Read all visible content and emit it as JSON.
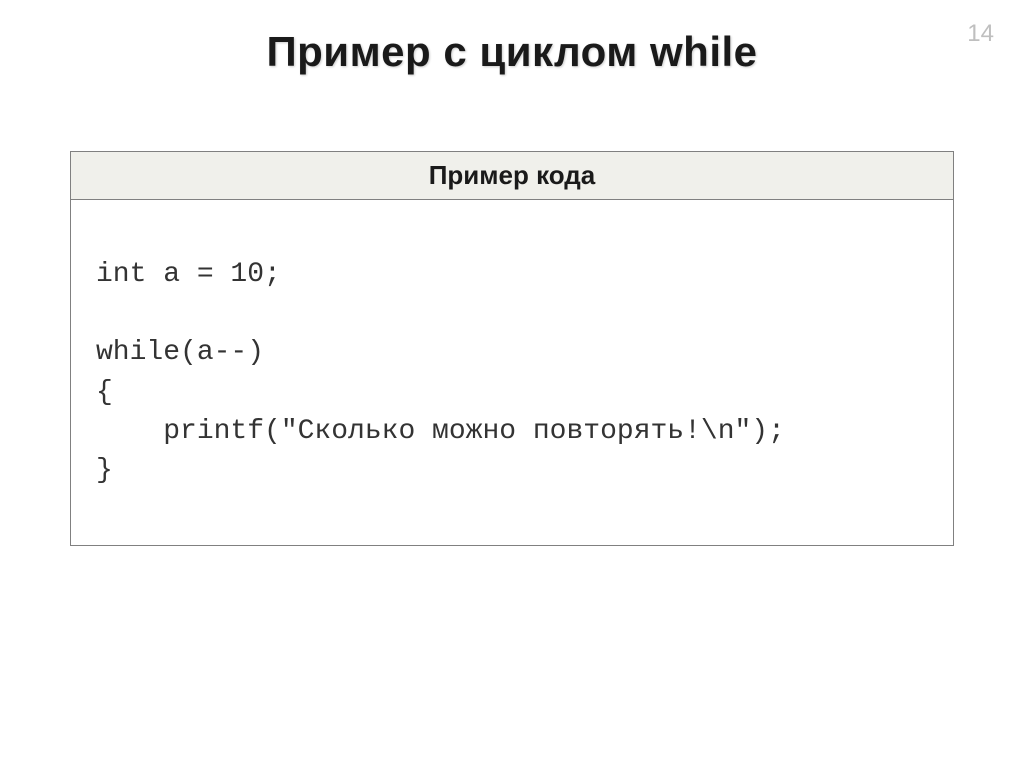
{
  "page_number": "14",
  "slide_title": "Пример с циклом while",
  "code_box": {
    "header": "Пример кода",
    "code": "int a = 10;\n\nwhile(a--)\n{\n    printf(\"Сколько можно повторять!\\n\");\n}"
  }
}
